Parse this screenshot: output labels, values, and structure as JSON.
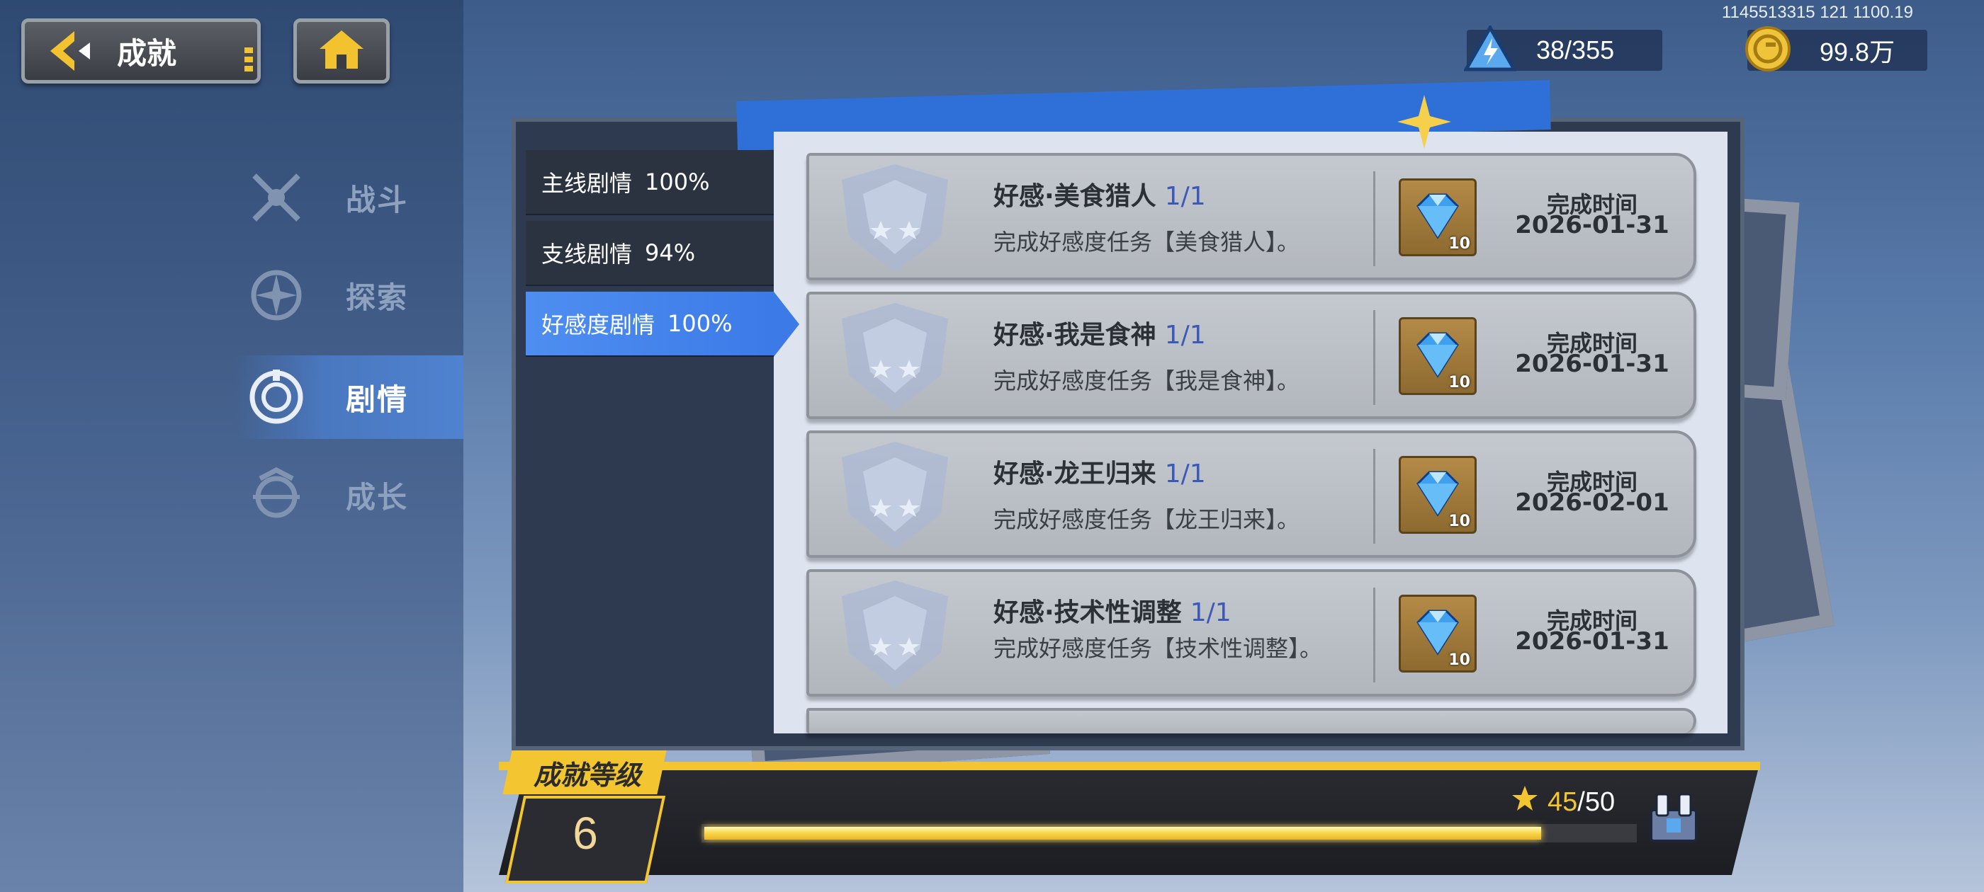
{
  "nav": {
    "back_label": "成就"
  },
  "sidebar": {
    "items": [
      {
        "label": "战斗",
        "icon": "crossed-swords-icon",
        "active": false
      },
      {
        "label": "探索",
        "icon": "compass-icon",
        "active": false
      },
      {
        "label": "剧情",
        "icon": "story-emblem-icon",
        "active": true
      },
      {
        "label": "成长",
        "icon": "growth-emblem-icon",
        "active": false
      }
    ]
  },
  "header": {
    "uid_text": "1145513315 121 1100.19",
    "stamina": {
      "icon": "stamina-triangle-icon",
      "value": "38/355"
    },
    "coins": {
      "icon": "gold-coin-icon",
      "value": "99.8万"
    }
  },
  "categories": [
    {
      "label": "主线剧情",
      "percent": "100%",
      "active": false
    },
    {
      "label": "支线剧情",
      "percent": "94%",
      "active": false
    },
    {
      "label": "好感度剧情",
      "percent": "100%",
      "active": true
    }
  ],
  "achievements": [
    {
      "title": "好感·美食猎人",
      "progress": "1/1",
      "desc": "完成好感度任务【美食猎人】。",
      "reward_qty": "10",
      "time_label": "完成时间",
      "time": "2026-01-31"
    },
    {
      "title": "好感·我是食神",
      "progress": "1/1",
      "desc": "完成好感度任务【我是食神】。",
      "reward_qty": "10",
      "time_label": "完成时间",
      "time": "2026-01-31"
    },
    {
      "title": "好感·龙王归来",
      "progress": "1/1",
      "desc": "完成好感度任务【龙王归来】。",
      "reward_qty": "10",
      "time_label": "完成时间",
      "time": "2026-02-01"
    },
    {
      "title": "好感·技术性调整",
      "progress": "1/1",
      "desc": "完成好感度任务【技术性调整】。",
      "reward_qty": "10",
      "time_label": "完成时间",
      "time": "2026-01-31"
    }
  ],
  "level": {
    "tag": "成就等级",
    "value": "6",
    "xp_current": "45",
    "xp_total": "/50",
    "xp_fraction": 0.9
  },
  "colors": {
    "accent_blue": "#4f8ef0",
    "gold": "#f2c531"
  }
}
